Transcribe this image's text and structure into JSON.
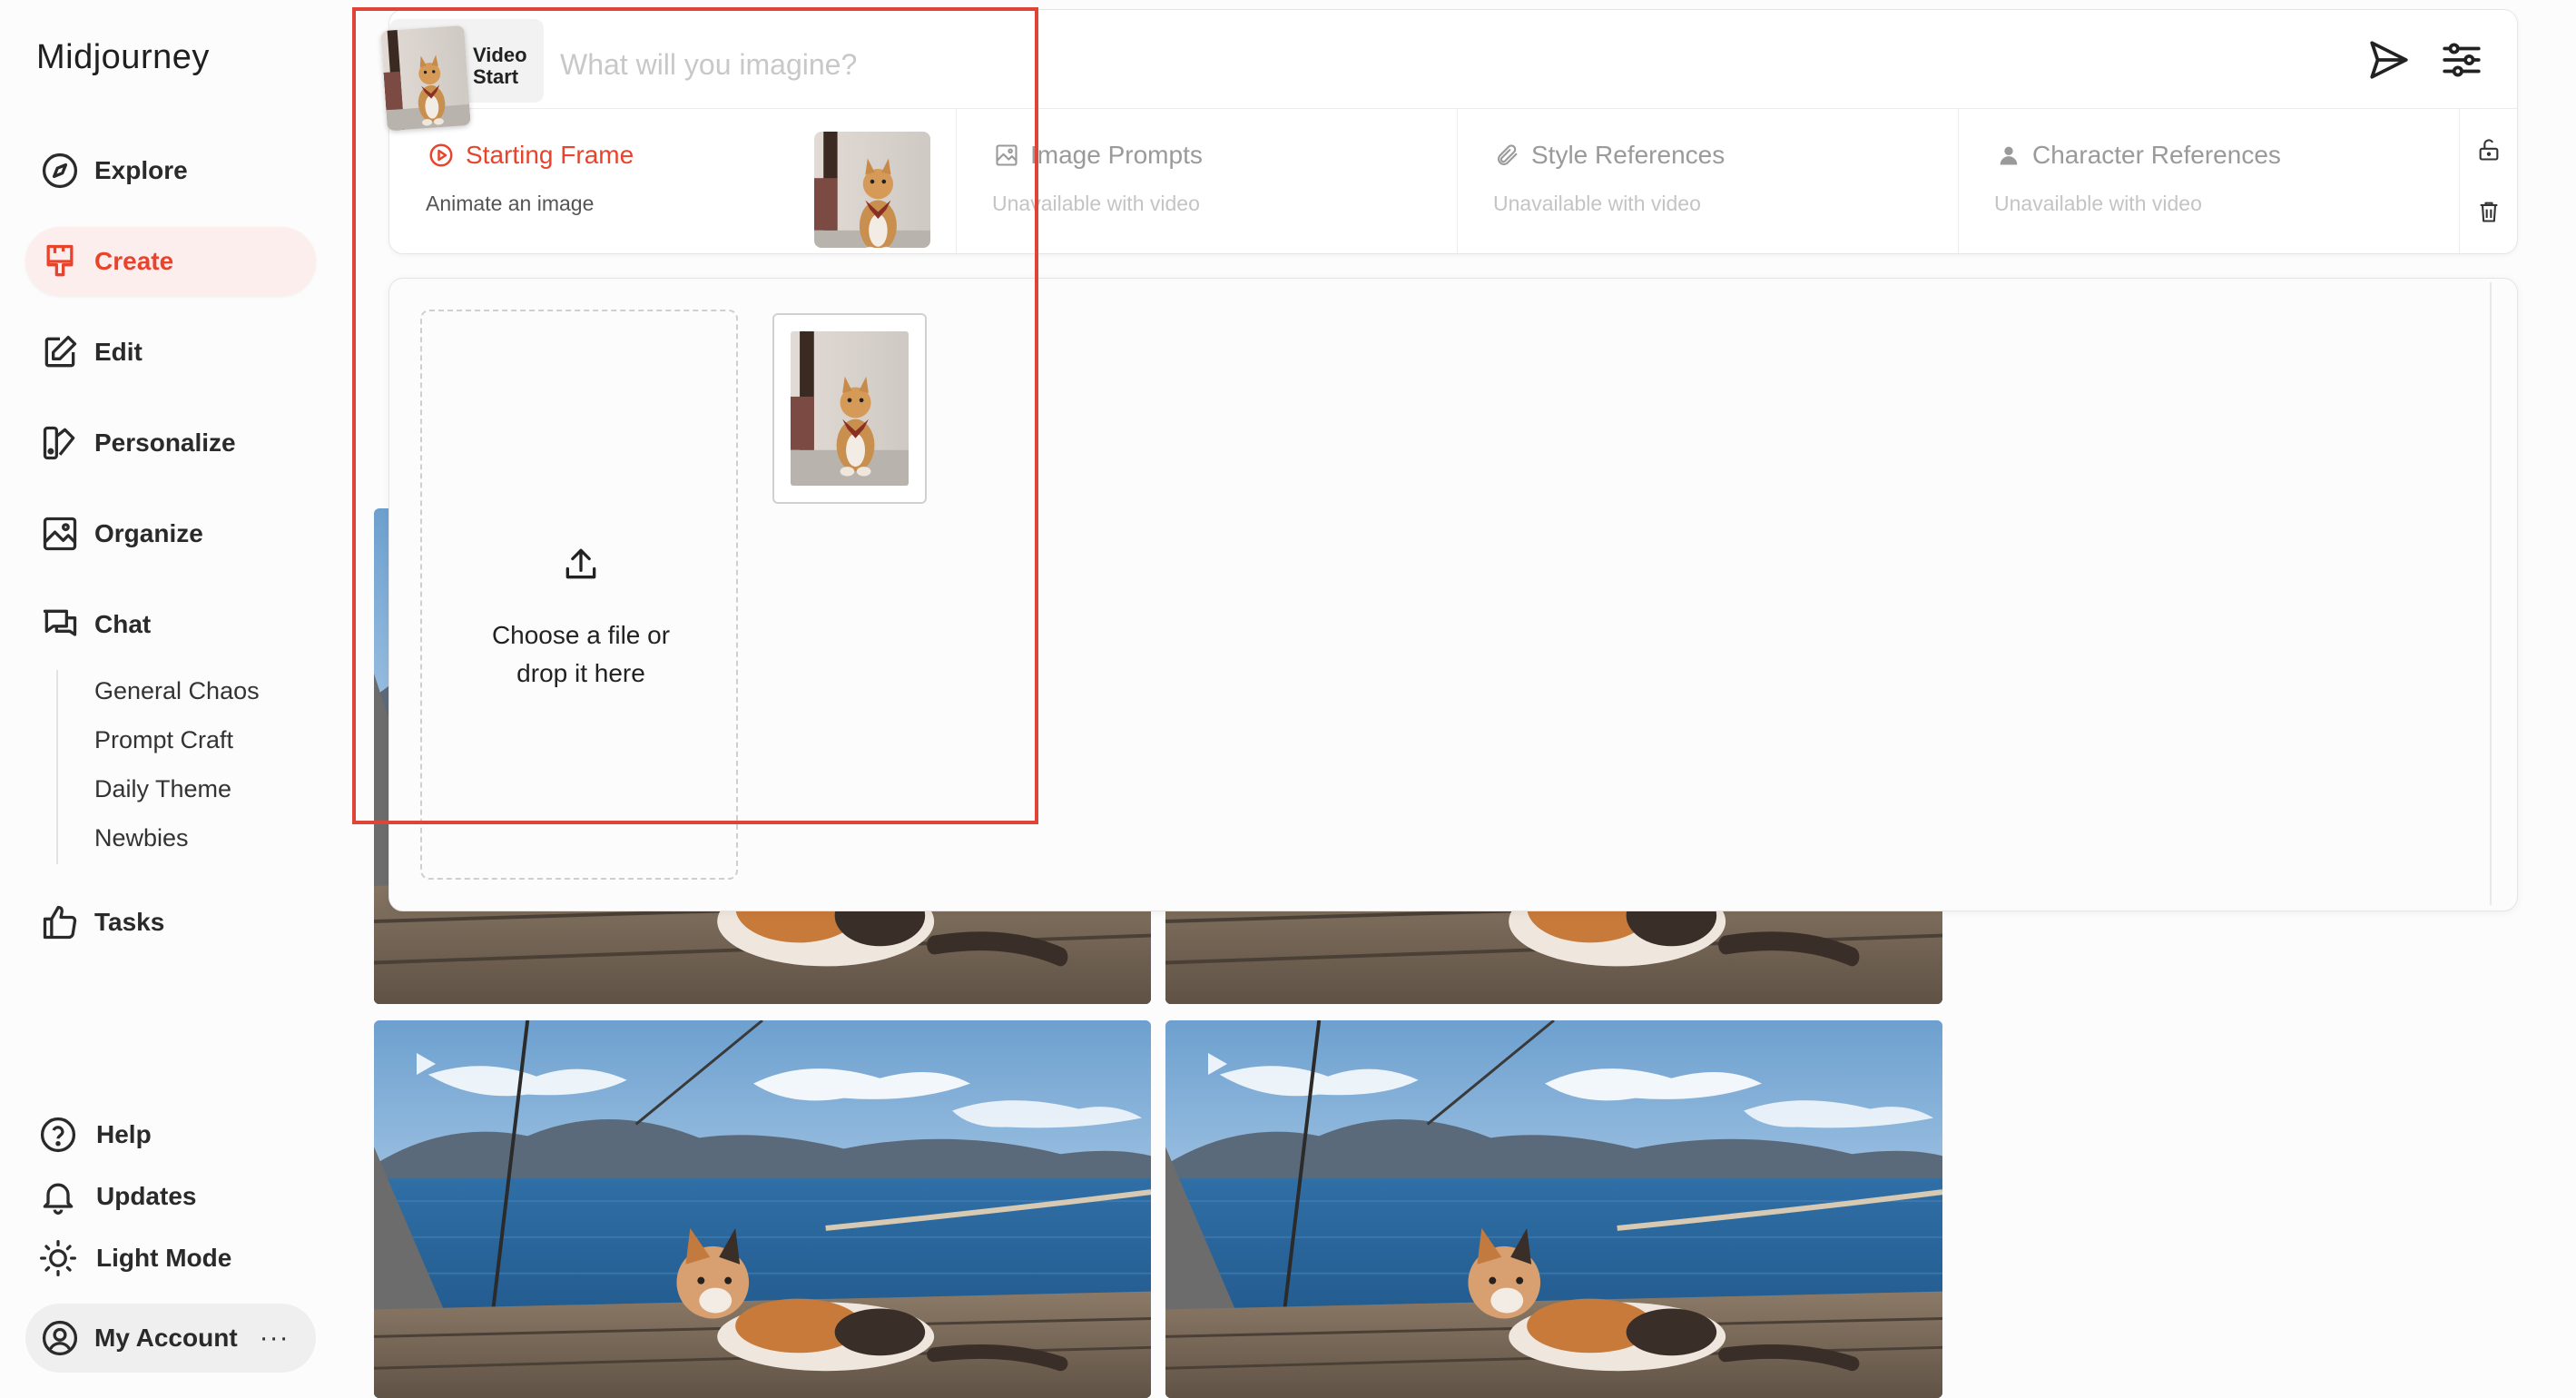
{
  "brand": "Midjourney",
  "nav": {
    "explore": "Explore",
    "create": "Create",
    "edit": "Edit",
    "personalize": "Personalize",
    "organize": "Organize",
    "chat": "Chat",
    "tasks": "Tasks"
  },
  "chat_rooms": [
    "General Chaos",
    "Prompt Craft",
    "Daily Theme",
    "Newbies"
  ],
  "footer": {
    "help": "Help",
    "updates": "Updates",
    "light_mode": "Light Mode",
    "account": "My Account",
    "more": "···"
  },
  "prompt": {
    "mode_line1": "Video",
    "mode_line2": "Start",
    "placeholder": "What will you imagine?"
  },
  "tabs": [
    {
      "title": "Starting Frame",
      "subtitle": "Animate an image",
      "icon": "play-circle-icon",
      "state": "active"
    },
    {
      "title": "Image Prompts",
      "subtitle": "Unavailable with video",
      "icon": "image-icon",
      "state": "disabled"
    },
    {
      "title": "Style References",
      "subtitle": "Unavailable with video",
      "icon": "paperclip-icon",
      "state": "disabled"
    },
    {
      "title": "Character References",
      "subtitle": "Unavailable with video",
      "icon": "person-icon",
      "state": "disabled"
    }
  ],
  "upload": {
    "line1": "Choose a file or",
    "line2": "drop it here"
  },
  "colors": {
    "accent": "#e8432c",
    "accent_bg": "#fdeeee",
    "highlight_border": "#e04434"
  }
}
